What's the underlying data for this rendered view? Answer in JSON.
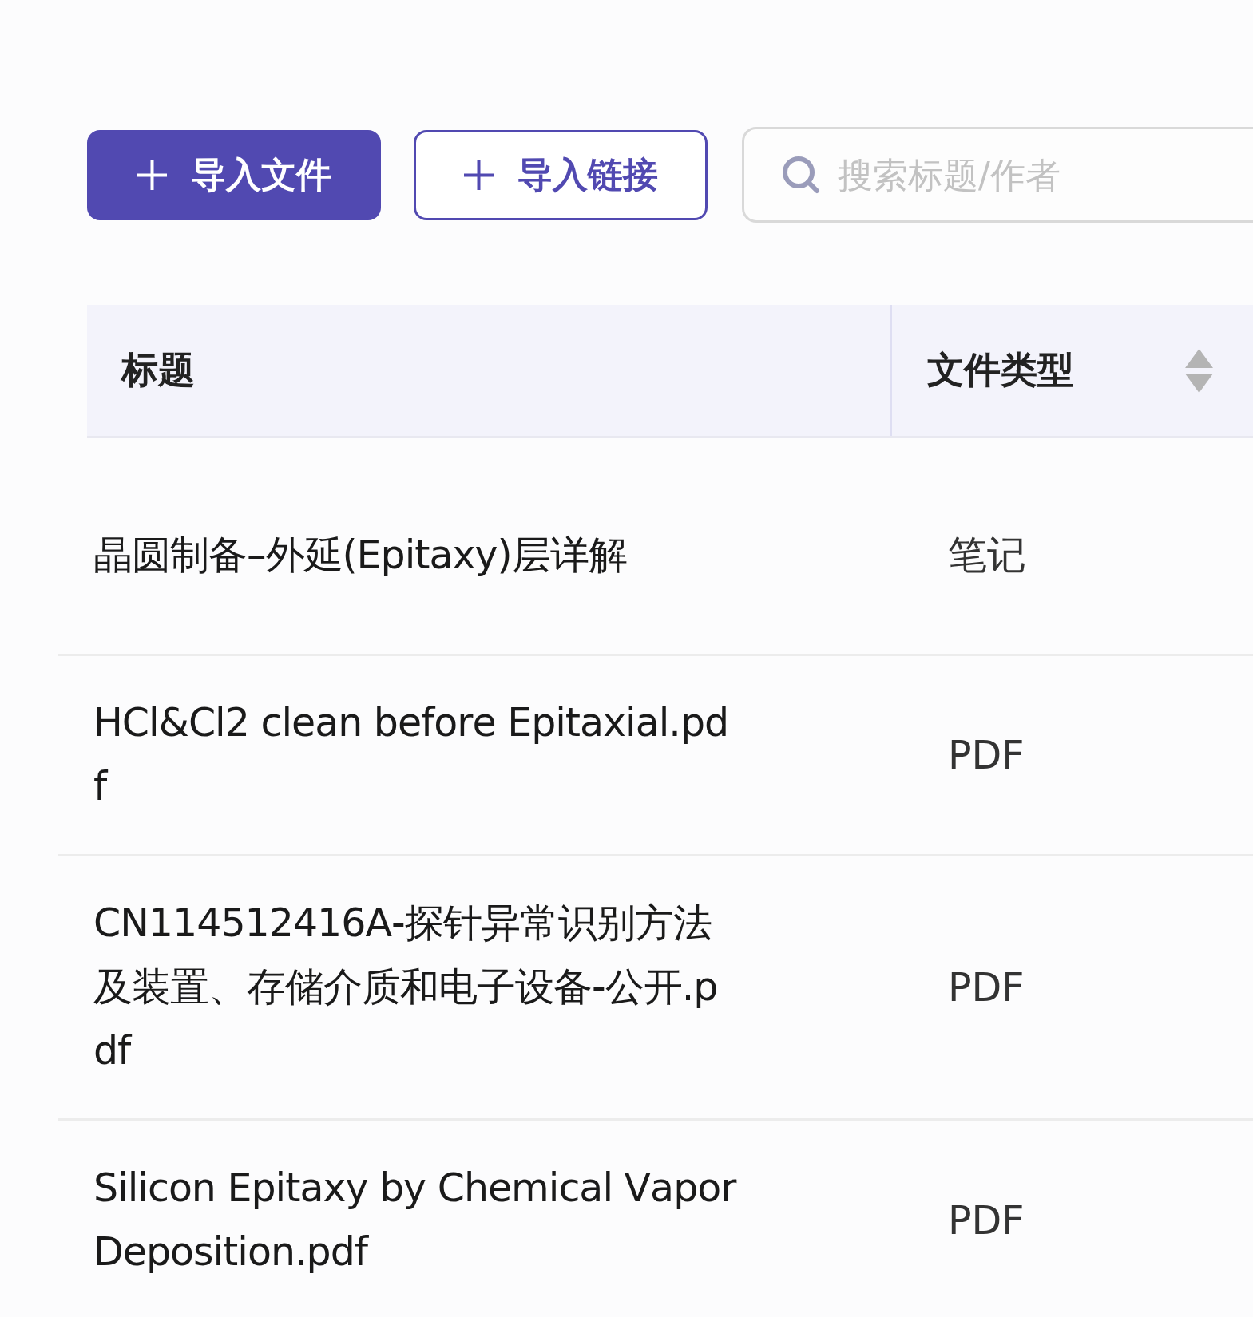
{
  "toolbar": {
    "buttons": [
      {
        "label": "导入文件",
        "kind": "primary"
      },
      {
        "label": "导入链接",
        "kind": "outline"
      }
    ],
    "search": {
      "placeholder": "搜索标题/作者"
    }
  },
  "table": {
    "columns": [
      {
        "label": "标题",
        "sortable": false
      },
      {
        "label": "文件类型",
        "sortable": true
      }
    ],
    "rows": [
      {
        "title": "晶圆制备–外延(Epitaxy)层详解",
        "file_type": "笔记"
      },
      {
        "title": "HCl&Cl2 clean before Epitaxial.pdf",
        "file_type": "PDF"
      },
      {
        "title": "CN114512416A-探针异常识别方法及装置、存储介质和电子设备-公开.pdf",
        "file_type": "PDF"
      },
      {
        "title": "Silicon Epitaxy by Chemical Vapor Deposition.pdf",
        "file_type": "PDF"
      }
    ]
  }
}
